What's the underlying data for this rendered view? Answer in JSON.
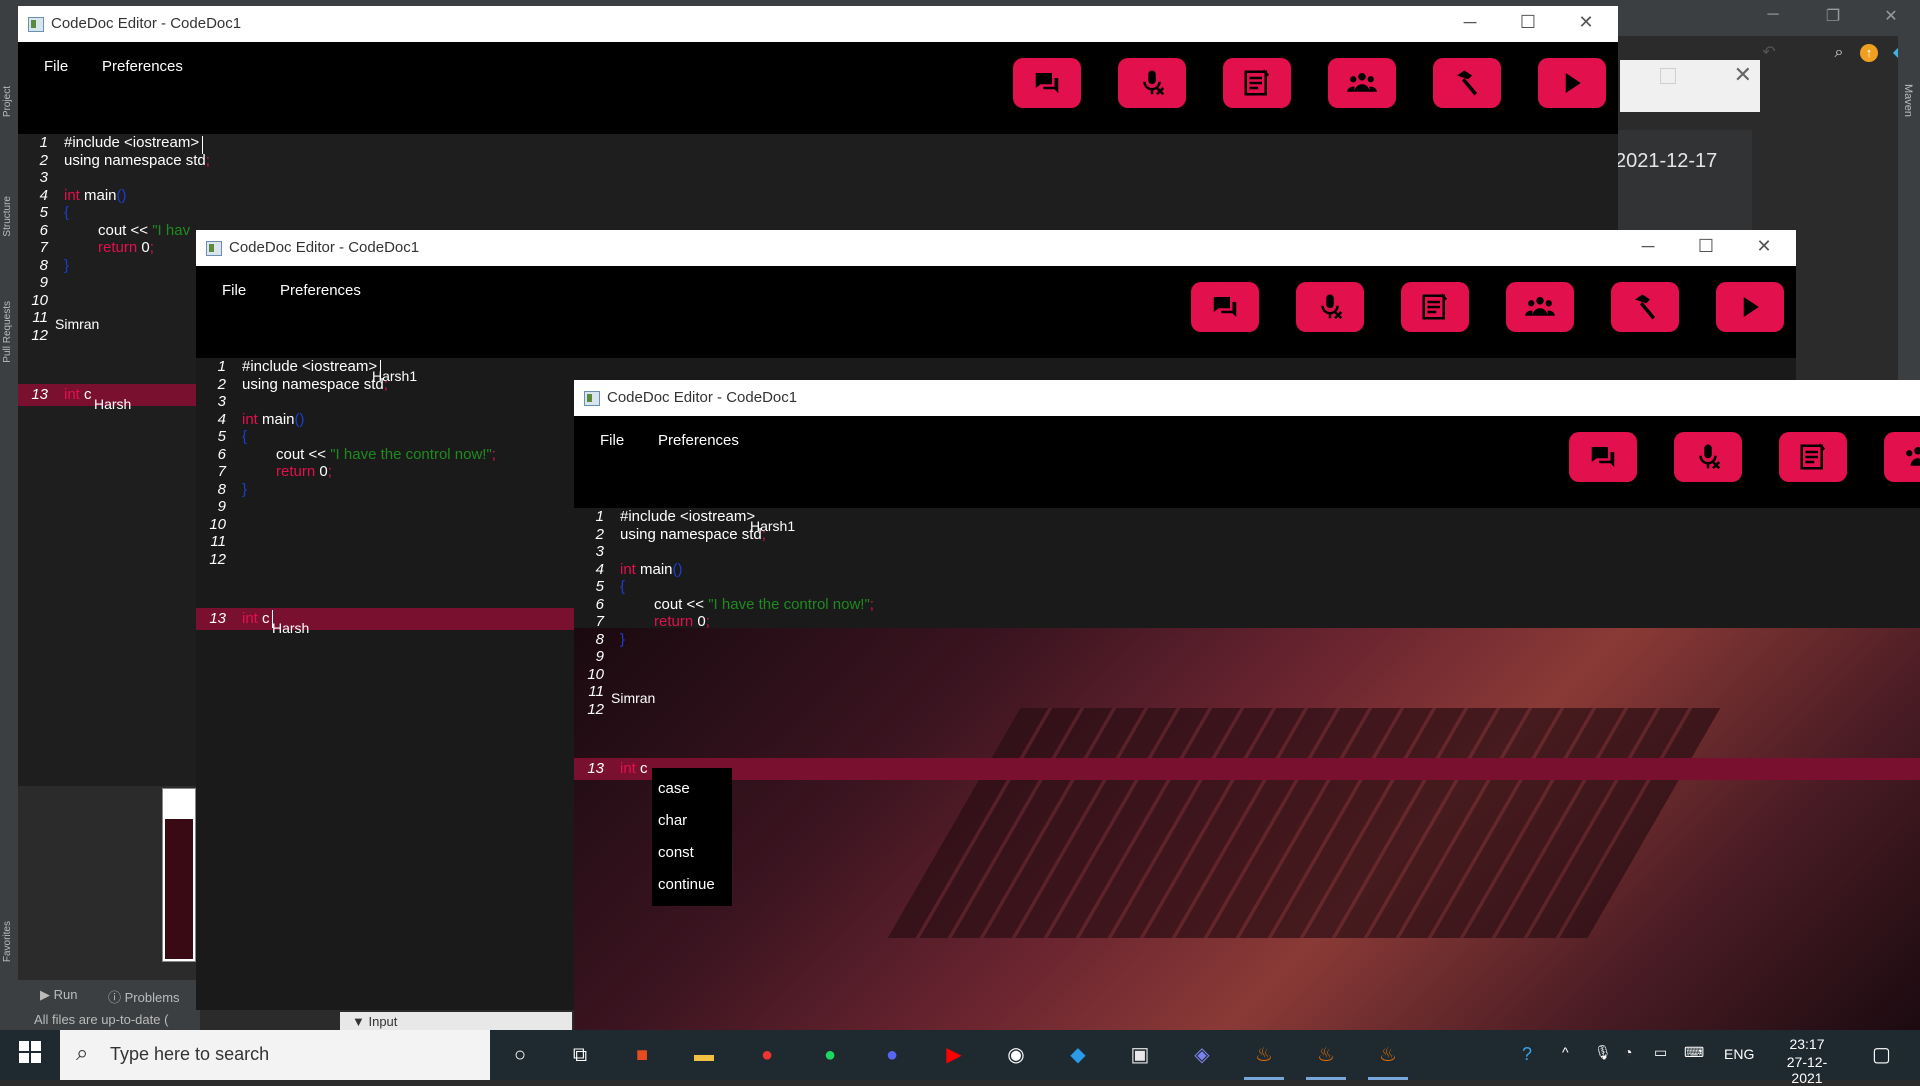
{
  "background_ide": {
    "date_text": "2021-12-17",
    "left_tabs": [
      "Project",
      "Structure",
      "Pull Requests",
      "Favorites"
    ],
    "right_tab": "Maven",
    "run_tab": "Run",
    "problems_tab": "Problems",
    "status_text": "All files are up-to-date (",
    "input_tab": "Input"
  },
  "windows": [
    {
      "title": "CodeDoc Editor - CodeDoc1",
      "menu": [
        "File",
        "Preferences"
      ],
      "line_numbers": [
        "1",
        "2",
        "3",
        "4",
        "5",
        "6",
        "7",
        "8",
        "9",
        "10",
        "11",
        "12",
        "13"
      ],
      "cursor_users": [
        "Simran",
        "Harsh"
      ]
    },
    {
      "title": "CodeDoc Editor - CodeDoc1",
      "menu": [
        "File",
        "Preferences"
      ],
      "cursor_users": [
        "Harsh1",
        "Harsh"
      ]
    },
    {
      "title": "CodeDoc Editor - CodeDoc1",
      "menu": [
        "File",
        "Preferences"
      ],
      "cursor_users": [
        "Harsh1",
        "Simran"
      ]
    }
  ],
  "code": {
    "l1": "#include <iostream>",
    "l2_a": "using namespace std",
    "l2_b": ";",
    "l4_kw": "int",
    "l4_b": " main",
    "l4_c": "()",
    "l5": "{",
    "l6_a": "cout << ",
    "l6_str": "\"I have the control now!\"",
    "l6_end": ";",
    "l6_str_trunc": "\"I hav",
    "l7_kw": "return",
    "l7_b": " 0",
    "l7_c": ";",
    "l8": "}",
    "l13_kw": "int",
    "l13_b": " c"
  },
  "toolbar_icons": [
    "chat-icon",
    "mic-off-icon",
    "notes-icon",
    "users-icon",
    "build-hammer-icon",
    "run-play-icon"
  ],
  "autocomplete": [
    "case",
    "char",
    "const",
    "continue"
  ],
  "taskbar": {
    "search_placeholder": "Type here to search",
    "lang": "ENG",
    "time": "23:17",
    "date": "27-12-2021"
  },
  "colors": {
    "accent": "#e2104c",
    "highlight_line": "#7a1030",
    "string": "#1f8a1f"
  }
}
